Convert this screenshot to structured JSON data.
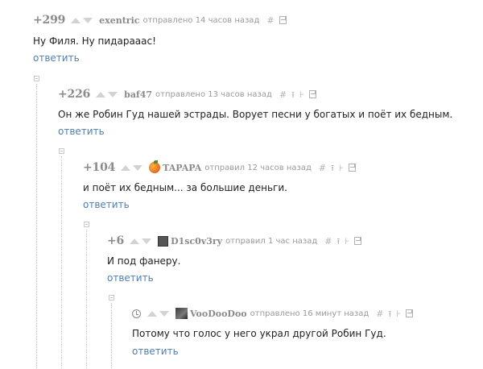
{
  "comments": [
    {
      "rating": "+299",
      "user": "exentric",
      "meta": "отправлено 14 часов назад",
      "text": "Ну Филя. Ну пидарааас!",
      "reply": "ответить"
    },
    {
      "rating": "+226",
      "user": "baf47",
      "meta": "отправлено 13 часов назад",
      "text": "Он же Робин Гуд нашей эстрады. Ворует песни у богатых и поёт их бедным.",
      "reply": "ответить"
    },
    {
      "rating": "+104",
      "user": "TAPAPA",
      "meta": "отправил 12 часов назад",
      "text": "и поёт их бедным... за большие деньги.",
      "reply": "ответить"
    },
    {
      "rating": "+6",
      "user": "D1sc0v3ry",
      "meta": "отправил 1 час назад",
      "text": "И под фанеру.",
      "reply": "ответить"
    },
    {
      "rating": "",
      "user": "VooDooDoo",
      "meta": "отправлено 16 минут назад",
      "text": "Потому что голос у него украл другой Робин Гуд.",
      "reply": "ответить"
    }
  ],
  "icons": {
    "hash": "#",
    "up_thread": "⭱",
    "branch": "⊦"
  }
}
